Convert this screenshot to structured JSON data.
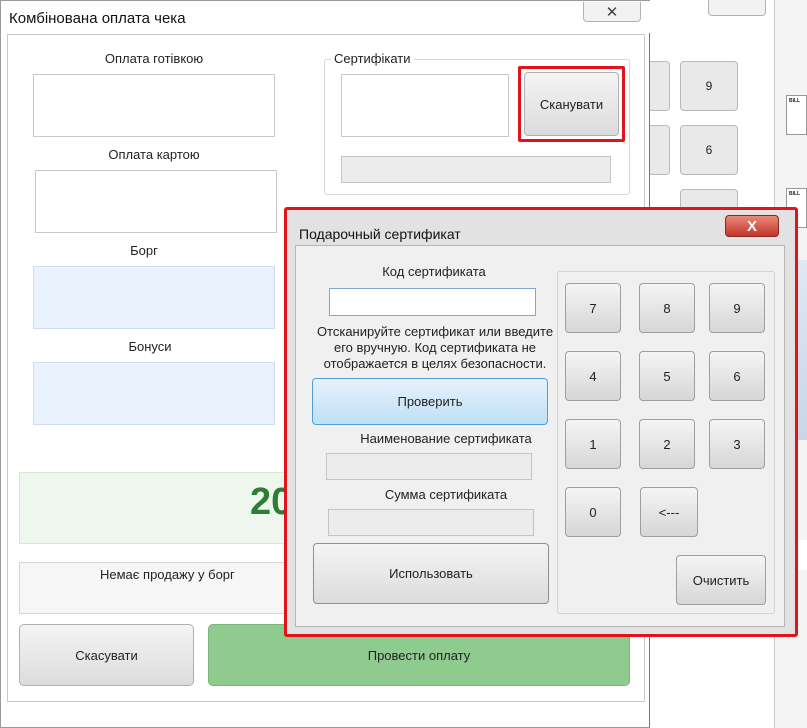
{
  "main_window": {
    "title": "Комбінована оплата чека",
    "close": "✕",
    "cash_label": "Оплата готівкою",
    "card_label": "Оплата картою",
    "debt_label": "Борг",
    "bonus_label": "Бонуси",
    "certificates_legend": "Сертифікати",
    "scan_button": "Сканувати",
    "total_partial": "20",
    "debt_message": "Немає продажу у борг",
    "cancel_button": "Скасувати",
    "pay_button": "Провести оплату"
  },
  "dialog": {
    "title": "Подарочный сертификат",
    "close": "X",
    "code_label": "Код сертификата",
    "code_value": "",
    "hint": "Отсканируйте сертификат или введите его вручную. Код сертификата не отображается в целях безопасности.",
    "check_button": "Проверить",
    "name_label": "Наименование сертификата",
    "sum_label": "Сумма сертификата",
    "use_button": "Использовать",
    "keypad": [
      "7",
      "8",
      "9",
      "4",
      "5",
      "6",
      "1",
      "2",
      "3",
      "0",
      "<---"
    ],
    "clear_button": "Очистить"
  },
  "background": {
    "keys": [
      "9",
      "6"
    ],
    "bill_label": "BILL"
  },
  "colors": {
    "highlight": "#e0141a",
    "pay_green": "#8fca8f",
    "total_green": "#2e7d32"
  }
}
